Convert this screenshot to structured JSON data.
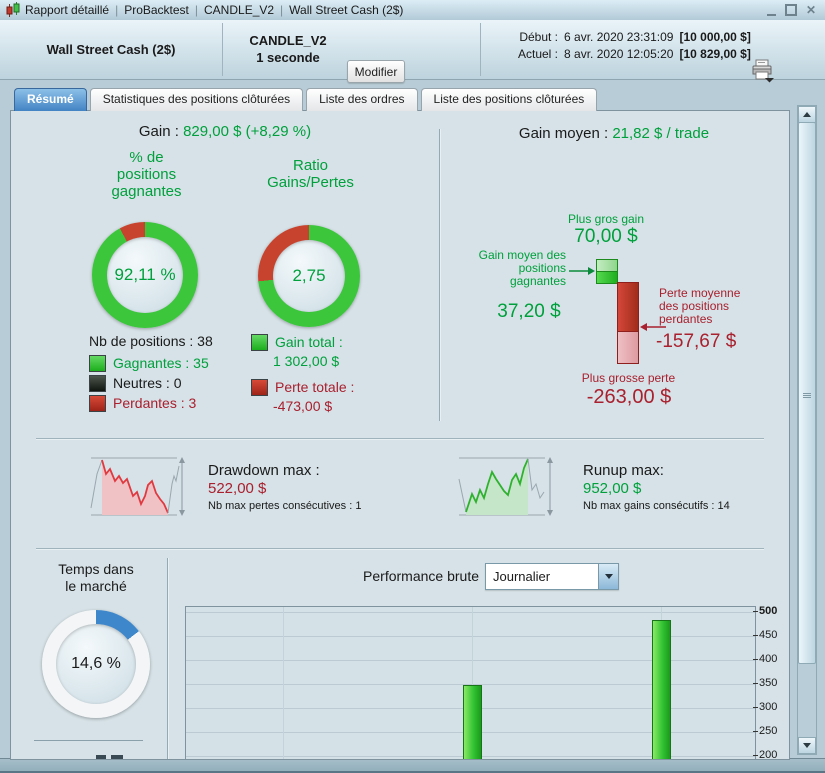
{
  "title_bar": {
    "parts": [
      "Rapport détaillé",
      "ProBacktest",
      "CANDLE_V2",
      "Wall Street Cash (2$)"
    ],
    "separator": "|",
    "icon": "candlestick-icon"
  },
  "header": {
    "instrument": "Wall Street Cash (2$)",
    "system_name": "CANDLE_V2",
    "timeframe": "1 seconde",
    "modify_button": "Modifier",
    "start_label": "Début :",
    "start_datetime": "6 avr. 2020 23:31:09",
    "start_value": "[10 000,00 $]",
    "current_label": "Actuel :",
    "current_datetime": "8 avr. 2020 12:05:20",
    "current_value": "[10 829,00 $]",
    "printer_icon": "printer-icon"
  },
  "tabs": {
    "items": [
      {
        "label": "Résumé",
        "active": true
      },
      {
        "label": "Statistiques des positions clôturées",
        "active": false
      },
      {
        "label": "Liste des ordres",
        "active": false
      },
      {
        "label": "Liste des positions clôturées",
        "active": false
      }
    ]
  },
  "summary": {
    "gain_label": "Gain : ",
    "gain_value": "829,00 $ (+8,29 %)",
    "winrate": {
      "title": "% de\npositions\ngagnantes",
      "value": "92,11 %",
      "pct": 92.11
    },
    "ratio": {
      "title": "Ratio\nGains/Pertes",
      "value": "2,75",
      "ratio": 2.75
    },
    "positions": {
      "total": "Nb de positions : 38",
      "winners": "Gagnantes : 35",
      "neutral": "Neutres : 0",
      "losers": "Perdantes : 3"
    },
    "totals": {
      "gain_label": "Gain total :",
      "gain_value": "1 302,00 $",
      "loss_label": "Perte totale :",
      "loss_value": "-473,00 $"
    },
    "avg_gain_label": "Gain moyen : ",
    "avg_gain_value": "21,82 $ / trade",
    "gain_bar": {
      "max_gain_label": "Plus gros gain",
      "max_gain_value": "70,00 $",
      "avg_win_label": "Gain moyen des\npositions\ngagnantes",
      "avg_win_value": "37,20 $",
      "avg_loss_label": "Perte moyenne\ndes positions\nperdantes",
      "avg_loss_value": "-157,67 $",
      "max_loss_label": "Plus grosse perte",
      "max_loss_value": "-263,00 $"
    }
  },
  "drawdown": {
    "label": "Drawdown max :",
    "value": "522,00 $",
    "sub": "Nb max pertes consécutives : 1"
  },
  "runup": {
    "label": "Runup max:",
    "value": "952,00 $",
    "sub": "Nb max gains consécutifs : 14"
  },
  "bottom": {
    "time_in_market": {
      "title": "Temps dans\nle marché",
      "value": "14,6 %",
      "pct": 14.6
    },
    "performance_label": "Performance brute",
    "period_dropdown": "Journalier"
  },
  "chart_data": {
    "type": "bar",
    "title": "Performance brute (Journalier)",
    "values": [
      348,
      483
    ],
    "yticks": [
      "500",
      "450",
      "400",
      "350",
      "300",
      "250",
      "200"
    ],
    "ylim": [
      200,
      500
    ],
    "grid": true,
    "bar_color": "#2ec22e"
  },
  "colors": {
    "green": "#00A03C",
    "dark_red": "#a9202e",
    "donut_green": "#3bc63b",
    "donut_red": "#c8432e",
    "donut_blue": "#3f87cb",
    "tab_active_blue": "#4283c4"
  }
}
